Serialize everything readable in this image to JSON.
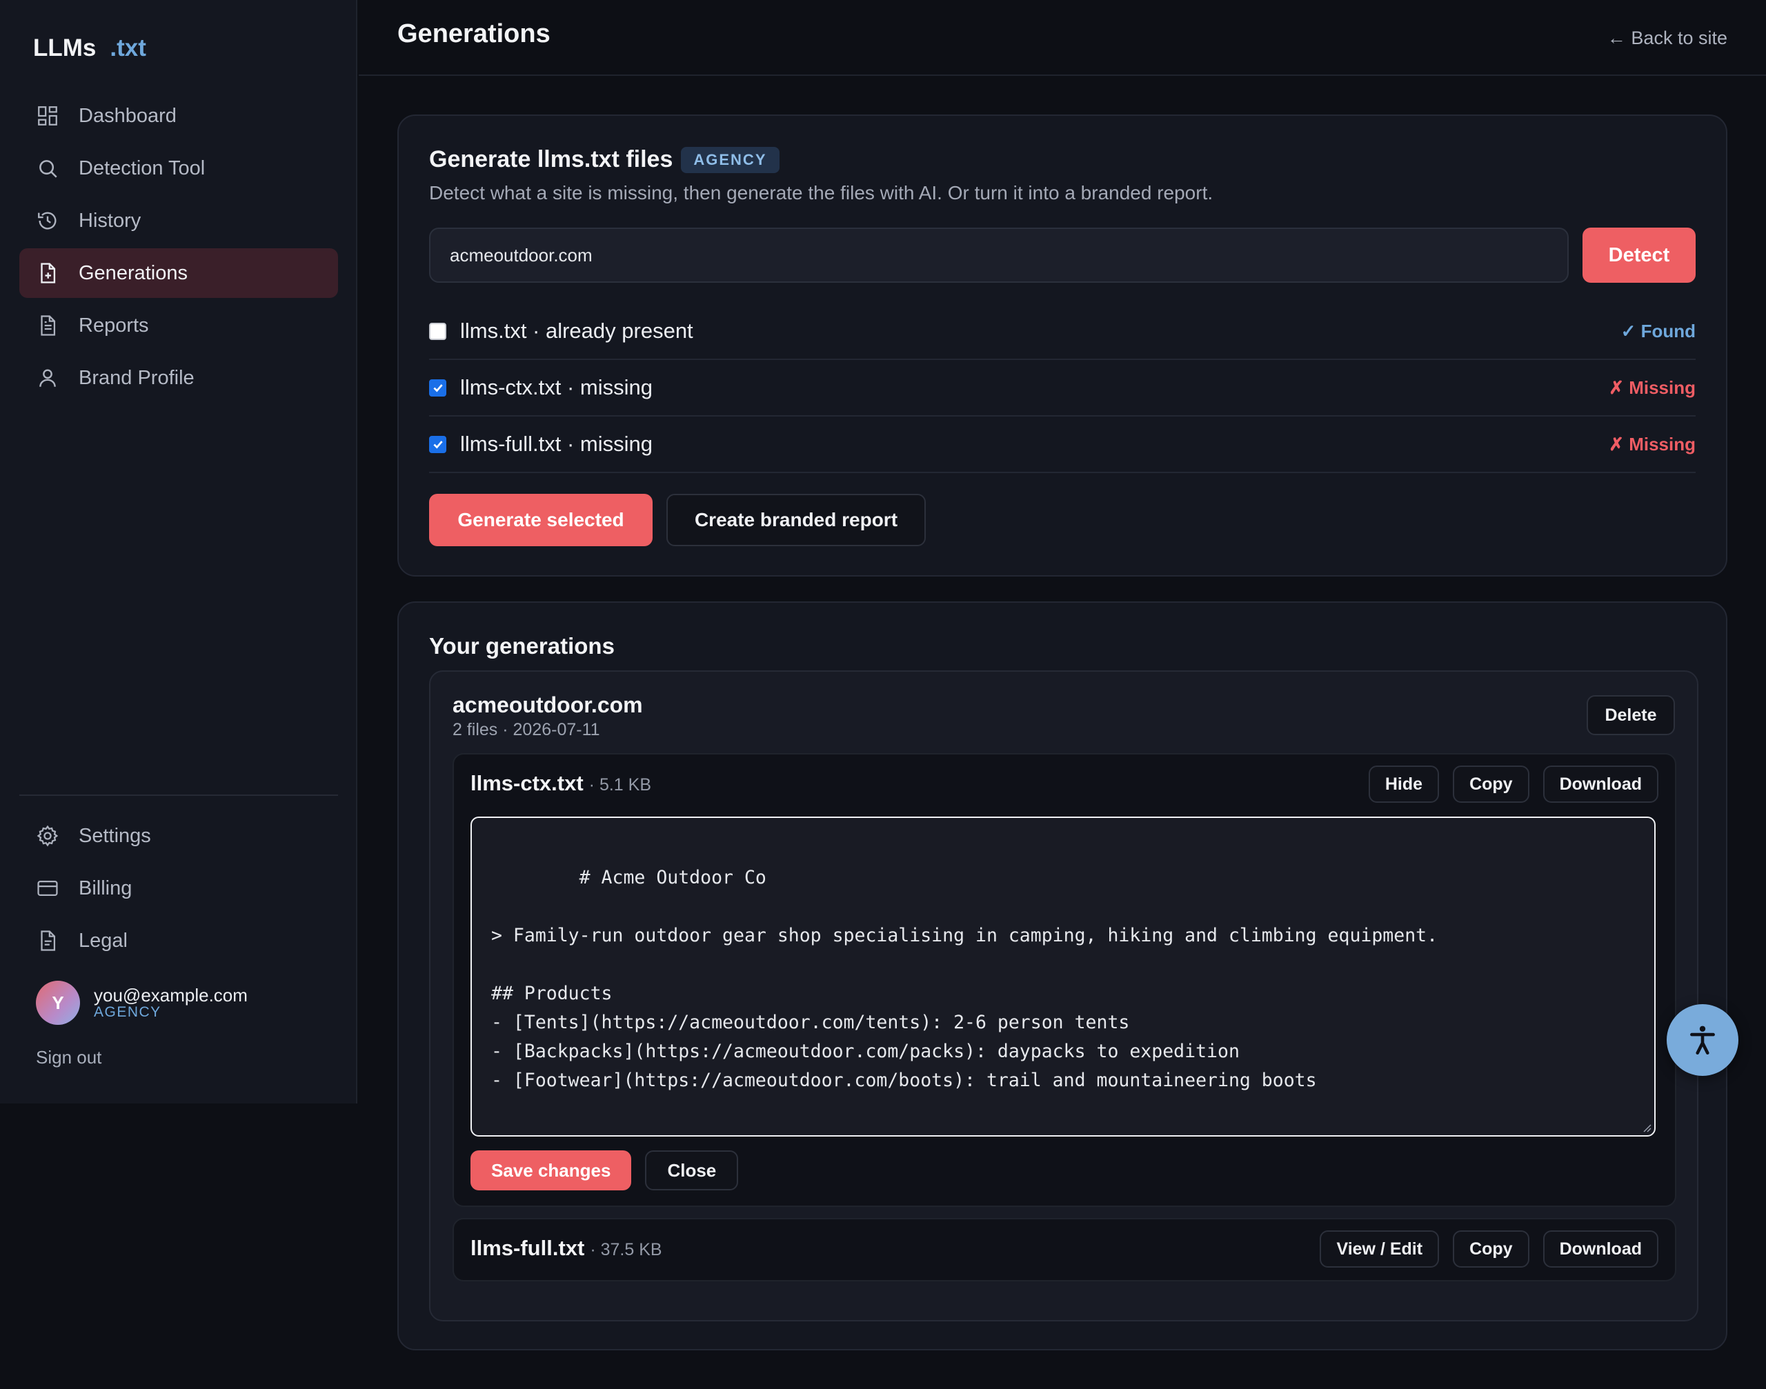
{
  "brand": {
    "name": "LLMs",
    "accent": ".txt"
  },
  "sidebar": {
    "items": [
      {
        "label": "Dashboard",
        "icon": "dashboard-icon"
      },
      {
        "label": "Detection Tool",
        "icon": "search-icon"
      },
      {
        "label": "History",
        "icon": "history-icon"
      },
      {
        "label": "Generations",
        "icon": "file-plus-icon",
        "active": true
      },
      {
        "label": "Reports",
        "icon": "file-text-icon"
      },
      {
        "label": "Brand Profile",
        "icon": "user-icon"
      }
    ],
    "bottom_items": [
      {
        "label": "Settings",
        "icon": "gear-icon"
      },
      {
        "label": "Billing",
        "icon": "credit-card-icon"
      },
      {
        "label": "Legal",
        "icon": "document-icon"
      }
    ],
    "user": {
      "initial": "Y",
      "email": "you@example.com",
      "plan": "AGENCY"
    },
    "sign_out": "Sign out"
  },
  "header": {
    "title": "Generations",
    "back_link": "← Back to site"
  },
  "generate": {
    "title": "Generate llms.txt files",
    "badge": "AGENCY",
    "subtitle": "Detect what a site is missing, then generate the files with AI. Or turn it into a branded report.",
    "input_value": "acmeoutdoor.com",
    "detect_label": "Detect",
    "files": [
      {
        "label": "llms.txt · already present",
        "checked": false,
        "status": "✓ Found",
        "status_type": "found"
      },
      {
        "label": "llms-ctx.txt · missing",
        "checked": true,
        "status": "✗ Missing",
        "status_type": "missing"
      },
      {
        "label": "llms-full.txt · missing",
        "checked": true,
        "status": "✗ Missing",
        "status_type": "missing"
      }
    ],
    "generate_label": "Generate selected",
    "report_label": "Create branded report"
  },
  "generations": {
    "title": "Your generations",
    "site": {
      "name": "acmeoutdoor.com",
      "meta": "2 files · 2026-07-11",
      "delete_label": "Delete",
      "files": [
        {
          "name": "llms-ctx.txt",
          "size": "· 5.1 KB",
          "hide_label": "Hide",
          "copy_label": "Copy",
          "download_label": "Download",
          "content": "# Acme Outdoor Co\n\n> Family-run outdoor gear shop specialising in camping, hiking and climbing equipment.\n\n## Products\n- [Tents](https://acmeoutdoor.com/tents): 2-6 person tents\n- [Backpacks](https://acmeoutdoor.com/packs): daypacks to expedition\n- [Footwear](https://acmeoutdoor.com/boots): trail and mountaineering boots",
          "save_label": "Save changes",
          "close_label": "Close"
        },
        {
          "name": "llms-full.txt",
          "size": "· 37.5 KB",
          "view_label": "View / Edit",
          "copy_label": "Copy",
          "download_label": "Download"
        }
      ]
    }
  },
  "colors": {
    "accent_red": "#ee5f63",
    "accent_blue": "#6fa8dc",
    "background": "#0d0f15",
    "card": "#141720"
  }
}
